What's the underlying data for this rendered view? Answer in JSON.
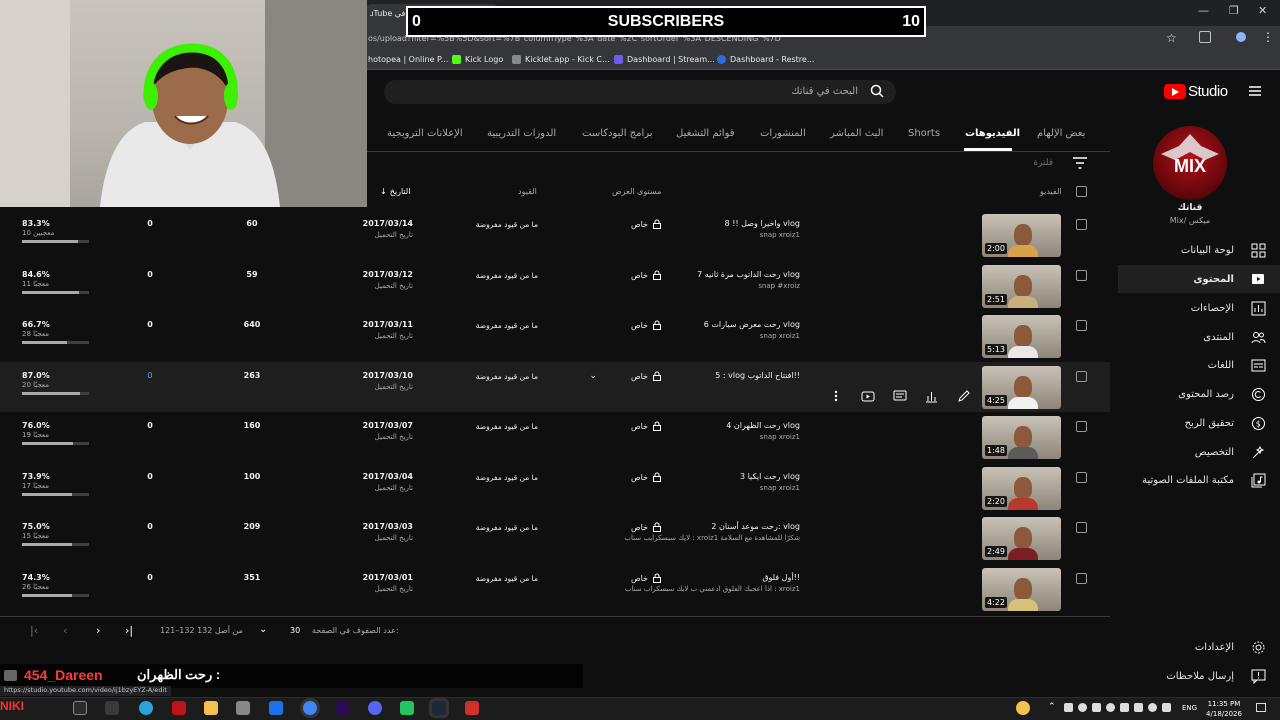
{
  "browser": {
    "tab_title": "استوديو صنّاع المحتوى في YouTube",
    "url": "os/upload?filter=%5B%5D&sort=%7B\"columnType\"%3A\"date\"%2C\"sortOrder\"%3A\"DESCENDING\"%7D",
    "bookmarks": [
      {
        "label": "hotopea | Online P...",
        "color": "#2aa3d8"
      },
      {
        "label": "Kick Logo",
        "color": "#53fc18"
      },
      {
        "label": "Kicklet.app - Kick C...",
        "color": "#888888"
      },
      {
        "label": "Dashboard | Stream...",
        "color": "#6c5ce7"
      },
      {
        "label": "Dashboard - Restre...",
        "color": "#2d6cdf"
      }
    ]
  },
  "overlay": {
    "sub_left": "0",
    "sub_title": "SUBSCRIBERS",
    "sub_right": "10",
    "chat_user": "454_Dareen",
    "chat_msg": "رحت الظهران :",
    "status_url": "https://studio.youtube.com/video/ij1bzyEYZ-A/edit",
    "streamer_tag": "NIKI"
  },
  "header": {
    "search_placeholder": "البحث في قناتك",
    "logo_text": "Studio"
  },
  "channel": {
    "name": "قناتك",
    "handle": "Mix/ ميكس",
    "avatar_text": "MIX"
  },
  "sidebar": {
    "items": [
      {
        "label": "لوحة البيانات",
        "icon": "dashboard-icon"
      },
      {
        "label": "المحتوى",
        "icon": "content-icon"
      },
      {
        "label": "الإحصاءات",
        "icon": "analytics-icon"
      },
      {
        "label": "المنتدى",
        "icon": "community-icon"
      },
      {
        "label": "اللغات",
        "icon": "subtitles-icon"
      },
      {
        "label": "رصد المحتوى",
        "icon": "copyright-icon"
      },
      {
        "label": "تحقيق الربح",
        "icon": "earn-icon"
      },
      {
        "label": "التخصيص",
        "icon": "customization-icon"
      },
      {
        "label": "مكتبة الملفات الصوتية",
        "icon": "audio-library-icon"
      }
    ],
    "settings": "الإعدادات",
    "feedback": "إرسال ملاحظات"
  },
  "tabs": [
    {
      "label": "بعض الإلهام",
      "active": false
    },
    {
      "label": "الفيديوهات",
      "active": true
    },
    {
      "label": "Shorts",
      "active": false
    },
    {
      "label": "البث المباشر",
      "active": false
    },
    {
      "label": "المنشورات",
      "active": false
    },
    {
      "label": "قوائم التشغيل",
      "active": false
    },
    {
      "label": "برامج البودكاست",
      "active": false
    },
    {
      "label": "الدورات التدريبية",
      "active": false
    },
    {
      "label": "الإعلانات الترويجية",
      "active": false
    }
  ],
  "filter_placeholder": "فلترة",
  "columns": {
    "video": "الفيديو",
    "visibility": "مستوى العرض",
    "restrictions": "القيود",
    "date": "التاريخ"
  },
  "rows": [
    {
      "title": "واخيرا وصل !! 8 vlog",
      "desc": "snap xroiz1",
      "duration": "2:00",
      "visibility": "خاص",
      "restrictions": "ما من قيود مفروضة",
      "date": "2017/03/14",
      "date_label": "تاريخ التحميل",
      "views": "60",
      "comments": "0",
      "likes_pct": "83.3%",
      "likes": "10 معجبين",
      "likes_frac": 0.833,
      "shirt": "#d9a24a"
    },
    {
      "title": "رحت الداتوب مرة ثانيه 7 vlog",
      "desc": "snap #xroiz",
      "duration": "2:51",
      "visibility": "خاص",
      "restrictions": "ما من قيود مفروضة",
      "date": "2017/03/12",
      "date_label": "تاريخ التحميل",
      "views": "59",
      "comments": "0",
      "likes_pct": "84.6%",
      "likes": "11 معجبًا",
      "likes_frac": 0.846,
      "shirt": "#c9b07a"
    },
    {
      "title": "رحت معرض سيارات 6 vlog",
      "desc": "snap xroiz1",
      "duration": "5:13",
      "visibility": "خاص",
      "restrictions": "ما من قيود مفروضة",
      "date": "2017/03/11",
      "date_label": "تاريخ التحميل",
      "views": "640",
      "comments": "0",
      "likes_pct": "66.7%",
      "likes": "28 معجبًا",
      "likes_frac": 0.667,
      "shirt": "#e8e8e8"
    },
    {
      "title": "5 : vlog افتتاح الداتوب!!",
      "desc": "",
      "duration": "4:25",
      "visibility": "خاص",
      "restrictions": "ما من قيود مفروضة",
      "date": "2017/03/10",
      "date_label": "تاريخ التحميل",
      "views": "263",
      "comments": "0",
      "likes_pct": "87.0%",
      "likes": "20 معجبًا",
      "likes_frac": 0.87,
      "shirt": "#f0f0f0",
      "hover": true
    },
    {
      "title": "رحت الظهران 4 vlog",
      "desc": "snap xroiz1",
      "duration": "1:48",
      "visibility": "خاص",
      "restrictions": "ما من قيود مفروضة",
      "date": "2017/03/07",
      "date_label": "تاريخ التحميل",
      "views": "160",
      "comments": "0",
      "likes_pct": "76.0%",
      "likes": "19 معجبًا",
      "likes_frac": 0.76,
      "shirt": "#5a5a5a"
    },
    {
      "title": "رحت ايكيا 3 vlog",
      "desc": "snap xroiz1",
      "duration": "2:20",
      "visibility": "خاص",
      "restrictions": "ما من قيود مفروضة",
      "date": "2017/03/04",
      "date_label": "تاريخ التحميل",
      "views": "100",
      "comments": "0",
      "likes_pct": "73.9%",
      "likes": "17 معجبًا",
      "likes_frac": 0.739,
      "shirt": "#b83a2e"
    },
    {
      "title": "رحت موعد أسنان 2: vlog",
      "desc": "لايك سبسكرايب سناب : xroiz1 شكرًا للمشاهدة مع السلامة",
      "duration": "2:49",
      "visibility": "خاص",
      "restrictions": "ما من قيود مفروضة",
      "date": "2017/03/03",
      "date_label": "تاريخ التحميل",
      "views": "209",
      "comments": "0",
      "likes_pct": "75.0%",
      "likes": "15 معجبًا",
      "likes_frac": 0.75,
      "shirt": "#7a1e22"
    },
    {
      "title": "أول فلوق!!",
      "desc": "اذا اعجبك الفلوق ادعمني ب لايك سبسكراب سناب : xroiz1",
      "duration": "4:22",
      "visibility": "خاص",
      "restrictions": "ما من قيود مفروضة",
      "date": "2017/03/01",
      "date_label": "تاريخ التحميل",
      "views": "351",
      "comments": "0",
      "likes_pct": "74.3%",
      "likes": "26 معجبًا",
      "likes_frac": 0.743,
      "shirt": "#d8c27a"
    }
  ],
  "pager": {
    "rows_per_page_label": "عدد الصفوف في الصفحة:",
    "rows_per_page": "30",
    "range": "121–132 من أصل 132"
  },
  "taskbar": {
    "time": "11:35 PM",
    "date": "4/18/2026",
    "lang": "ENG"
  }
}
